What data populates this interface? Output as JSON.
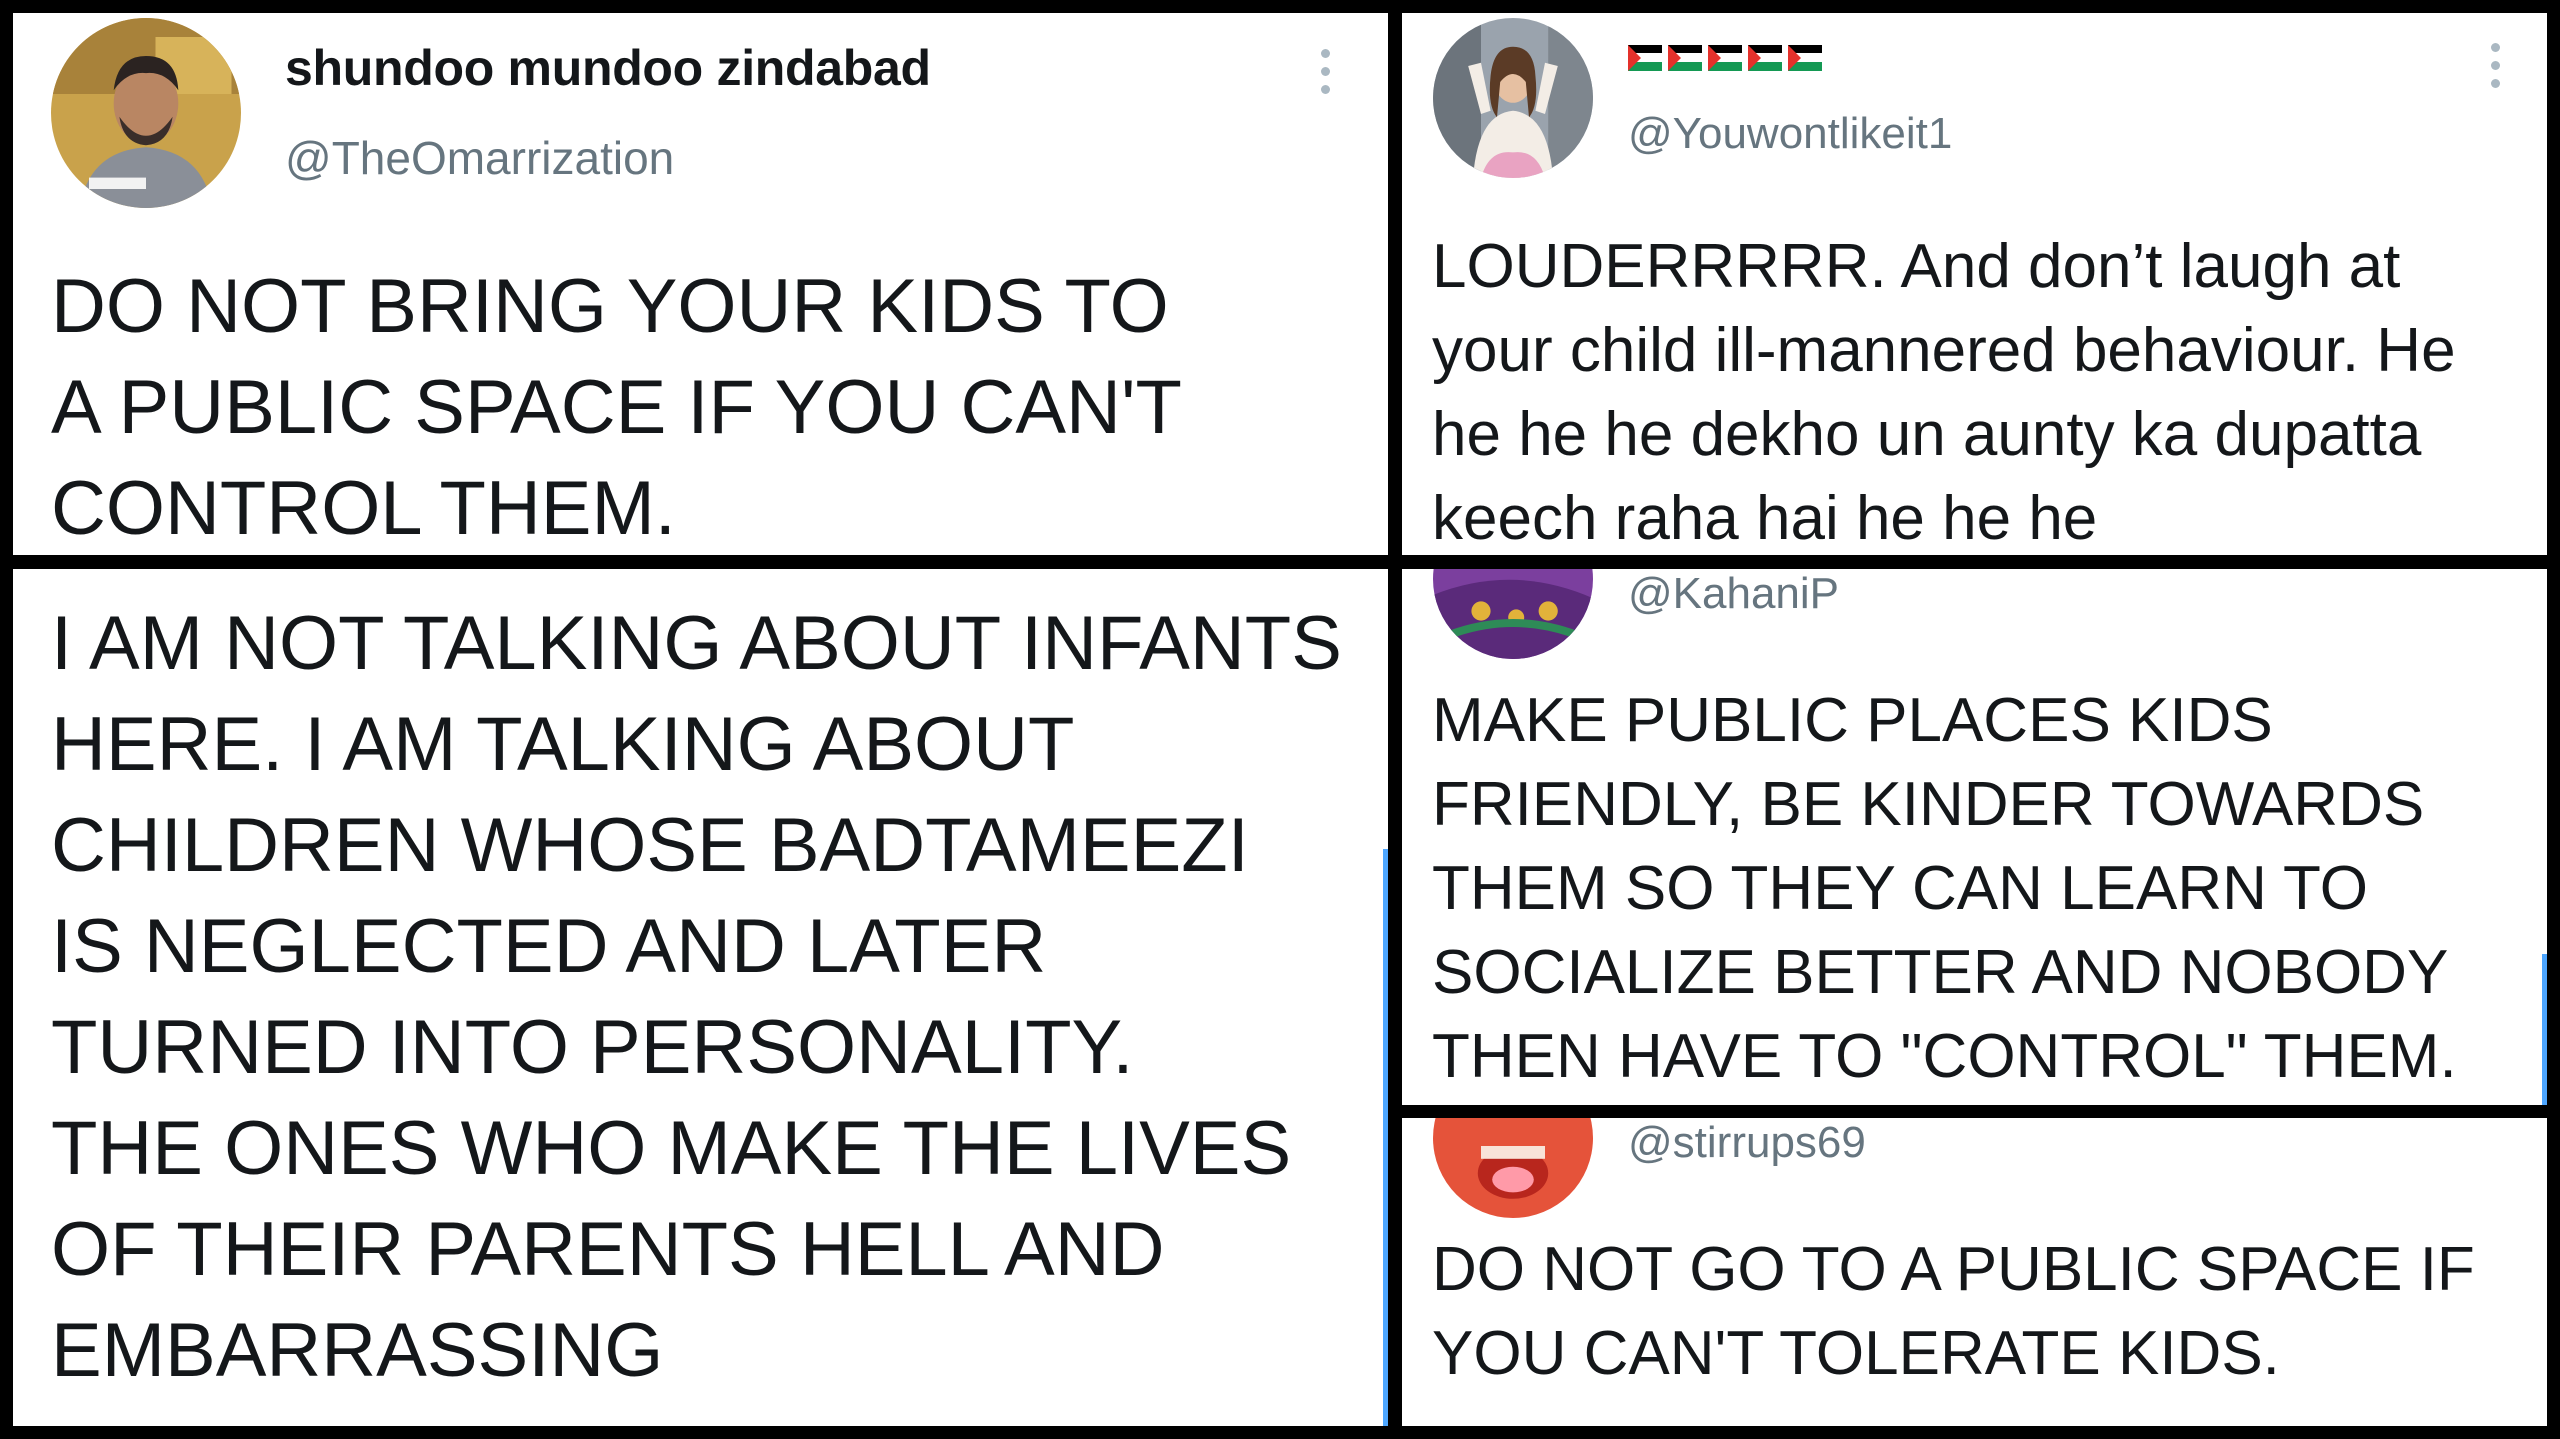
{
  "panel_a": {
    "display_name": "shundoo mundoo zindabad",
    "handle": "@TheOmarrization",
    "text_lines": [
      "DO NOT BRING YOUR KIDS TO",
      "A PUBLIC SPACE IF YOU CAN'T",
      "CONTROL THEM."
    ],
    "avatar_icon": "profile-photo-man",
    "more_icon": "more-vertical-icon"
  },
  "panel_b": {
    "display_name_flags": [
      "flag-icon",
      "flag-icon",
      "flag-icon",
      "flag-icon",
      "flag-icon"
    ],
    "handle": "@Youwontlikeit1",
    "text_lines": [
      "LOUDERRRRR. And don’t laugh at",
      "your child ill-mannered behaviour. He",
      "he he he dekho un aunty ka dupatta",
      "keech raha hai he he he"
    ],
    "avatar_icon": "profile-photo-woman",
    "more_icon": "more-vertical-icon"
  },
  "panel_c": {
    "text_lines": [
      "I AM NOT TALKING ABOUT INFANTS",
      "HERE. I AM TALKING ABOUT",
      "CHILDREN WHOSE BADTAMEEZI",
      "IS NEGLECTED AND LATER",
      "TURNED INTO PERSONALITY.",
      "THE ONES WHO MAKE THE LIVES",
      "OF THEIR PARENTS HELL AND",
      "EMBARRASSING"
    ]
  },
  "panel_d": {
    "handle": "@KahaniP",
    "text_lines": [
      "MAKE PUBLIC PLACES KIDS",
      "FRIENDLY, BE KINDER TOWARDS",
      "THEM SO THEY CAN LEARN TO",
      "SOCIALIZE BETTER AND NOBODY",
      "THEN HAVE TO \"CONTROL\" THEM."
    ],
    "avatar_icon": "profile-photo-illustration"
  },
  "panel_e": {
    "handle": "@stirrups69",
    "text_lines": [
      "DO NOT GO TO A PUBLIC SPACE IF",
      "YOU CAN'T TOLERATE KIDS."
    ],
    "avatar_icon": "profile-photo-face"
  },
  "colors": {
    "background": "#000000",
    "panel": "#ffffff",
    "text": "#14171a",
    "handle": "#66757f",
    "thread_line": "#4da6ff",
    "flag_red": "#e4312b",
    "flag_green": "#149954"
  }
}
